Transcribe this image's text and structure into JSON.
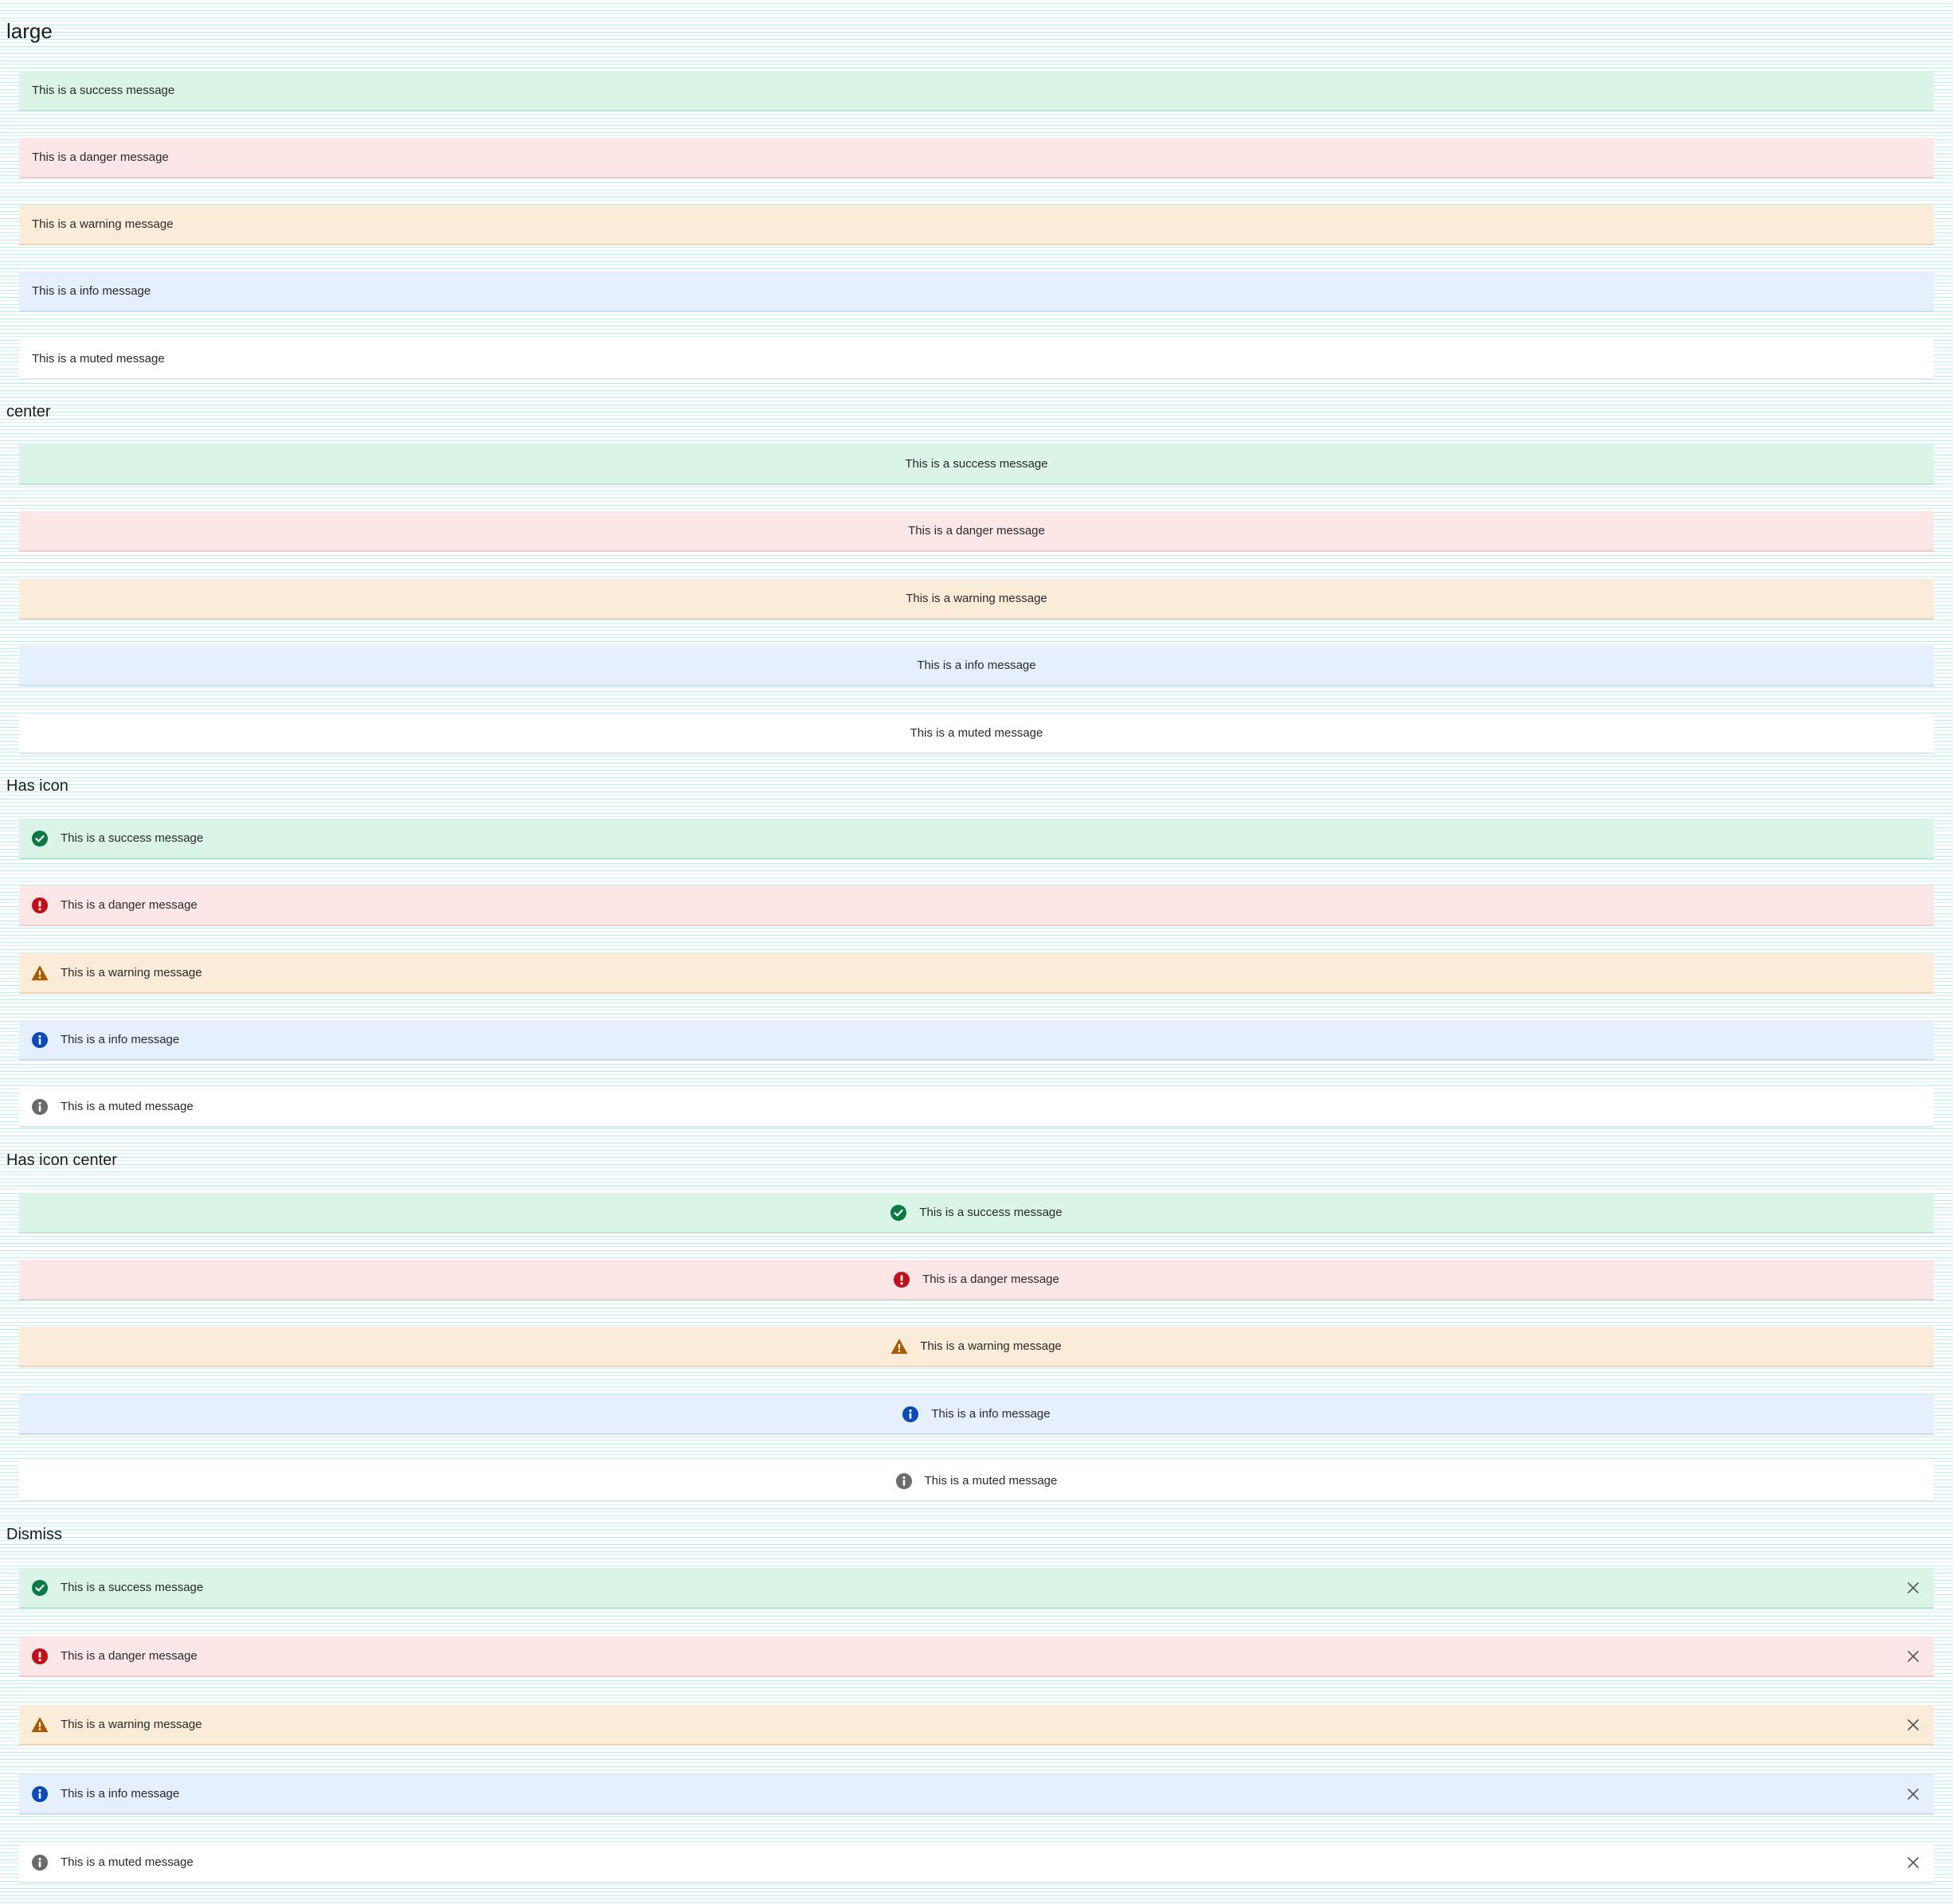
{
  "colors": {
    "success_bg": "#daf5e8",
    "danger_bg": "#fce6e6",
    "warning_bg": "#fbebd9",
    "info_bg": "#e5effd",
    "muted_bg": "#ffffff",
    "success_icon": "#0a7a45",
    "danger_icon": "#c0111a",
    "warning_icon": "#a85b00",
    "info_icon": "#0b4ab8",
    "muted_icon": "#6b6b6b"
  },
  "sections": {
    "large": {
      "title": "large",
      "messages": {
        "success": "This is a success message",
        "danger": "This is a danger message",
        "warning": "This is a warning message",
        "info": "This is a info message",
        "muted": "This is a muted message"
      }
    },
    "center": {
      "title": "center",
      "messages": {
        "success": "This is a success message",
        "danger": "This is a danger message",
        "warning": "This is a warning message",
        "info": "This is a info message",
        "muted": "This is a muted message"
      }
    },
    "has_icon": {
      "title": "Has icon",
      "messages": {
        "success": "This is a success message",
        "danger": "This is a danger message",
        "warning": "This is a warning message",
        "info": "This is a info message",
        "muted": "This is a muted message"
      },
      "icons": {
        "success": "check-circle-icon",
        "danger": "exclamation-circle-icon",
        "warning": "warning-triangle-icon",
        "info": "info-circle-icon",
        "muted": "info-circle-icon"
      }
    },
    "has_icon_center": {
      "title": "Has icon center",
      "messages": {
        "success": "This is a success message",
        "danger": "This is a danger message",
        "warning": "This is a warning message",
        "info": "This is a info message",
        "muted": "This is a muted message"
      }
    },
    "dismiss": {
      "title": "Dismiss",
      "messages": {
        "success": "This is a success message",
        "danger": "This is a danger message",
        "warning": "This is a warning message",
        "info": "This is a info message",
        "muted": "This is a muted message"
      },
      "close_icon": "close-icon"
    }
  }
}
